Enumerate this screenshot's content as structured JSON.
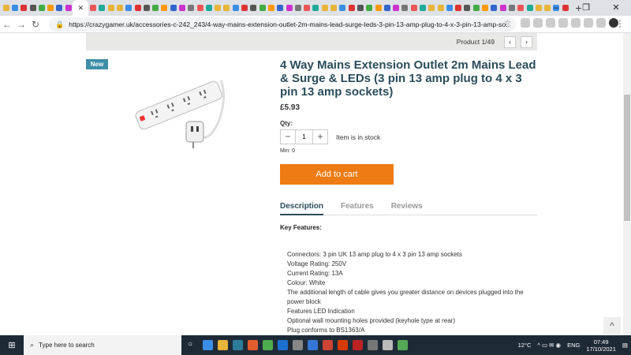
{
  "browser": {
    "url": "https://crazygamer.uk/accessories-c-242_243/4-way-mains-extension-outlet-2m-mains-lead-surge-leds-3-pin-13-amp-plug-to-4-x-3-pin-13-amp-so...",
    "new_tab_label": "+",
    "window_controls": [
      "–",
      "❐",
      "✕"
    ]
  },
  "page": {
    "product_counter": "Product 1/49",
    "prev_label": "‹",
    "next_label": "›",
    "badge": "New",
    "title": "4 Way Mains Extension Outlet 2m Mains Lead & Surge & LEDs (3 pin 13 amp plug to 4 x 3 pin 13 amp sockets)",
    "price": "£5.93",
    "qty_label": "Qty:",
    "qty_value": "1",
    "qty_minus": "−",
    "qty_plus": "+",
    "stock_status": "Item is in stock",
    "min_label": "Min:  0",
    "add_to_cart": "Add to cart",
    "tabs": [
      "Description",
      "Features",
      "Reviews"
    ],
    "key_features_heading": "Key Features:",
    "features": [
      "Connectors: 3 pin UK 13 amp plug to 4 x 3 pin 13 amp sockets",
      "Voltage Rating: 250V",
      "Current Rating: 13A",
      "Colour: White",
      "The additional length of cable gives you greater distance on devices plugged into the power block",
      "Features LED Indication",
      "Optional wall mounting holes provided (keyhole type at rear)",
      "Plug conforms to BS1363/A"
    ],
    "back_to_top": "^"
  },
  "taskbar": {
    "search_placeholder": "Type here to search",
    "weather": "12°C",
    "language": "ENG",
    "time": "07:49",
    "date": "17/10/2021"
  },
  "colors": {
    "accent_title": "#2b4d5c",
    "badge": "#3d8ea6",
    "add_to_cart": "#ee7b13"
  }
}
